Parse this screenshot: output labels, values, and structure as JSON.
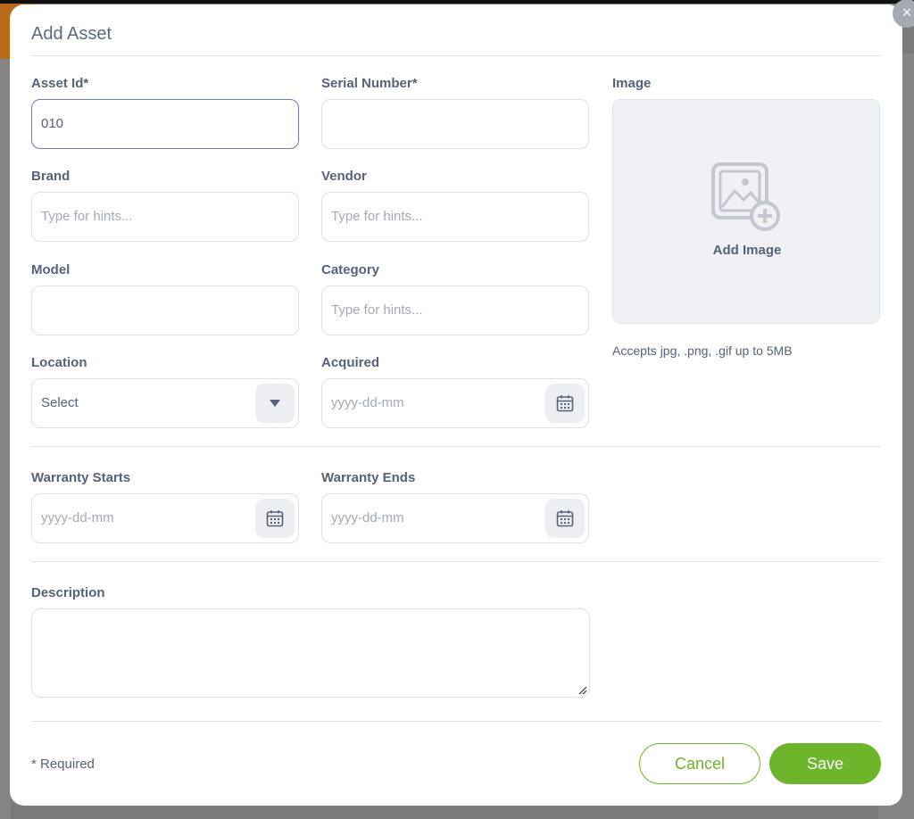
{
  "modal": {
    "title": "Add Asset",
    "close_glyph": "×"
  },
  "fields": {
    "asset_id": {
      "label": "Asset Id*",
      "value": "010"
    },
    "serial_number": {
      "label": "Serial Number*",
      "value": ""
    },
    "brand": {
      "label": "Brand",
      "placeholder": "Type for hints..."
    },
    "vendor": {
      "label": "Vendor",
      "placeholder": "Type for hints..."
    },
    "model": {
      "label": "Model",
      "value": ""
    },
    "category": {
      "label": "Category",
      "placeholder": "Type for hints..."
    },
    "location": {
      "label": "Location",
      "selected": "Select"
    },
    "acquired": {
      "label": "Acquired",
      "placeholder": "yyyy-dd-mm"
    },
    "warranty_starts": {
      "label": "Warranty Starts",
      "placeholder": "yyyy-dd-mm"
    },
    "warranty_ends": {
      "label": "Warranty Ends",
      "placeholder": "yyyy-dd-mm"
    },
    "description": {
      "label": "Description",
      "value": ""
    }
  },
  "image": {
    "label": "Image",
    "add_label": "Add Image",
    "accepts": "Accepts jpg, .png, .gif up to 5MB",
    "icon": "image-add-icon"
  },
  "footer": {
    "required_note": "* Required",
    "cancel_label": "Cancel",
    "save_label": "Save"
  },
  "colors": {
    "accent": "#6fb52b",
    "text": "#55627a",
    "active_border": "#6f7cb3"
  }
}
